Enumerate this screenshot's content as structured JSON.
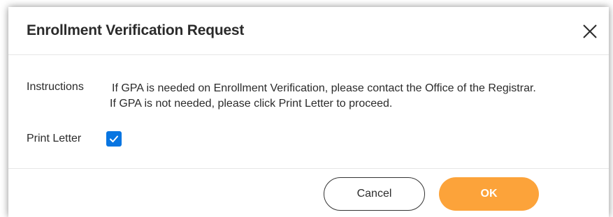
{
  "dialog": {
    "title": "Enrollment Verification Request",
    "close_icon": "close-icon"
  },
  "form": {
    "instructions_label": "Instructions",
    "instructions_line1": "If GPA is needed on Enrollment Verification, please contact the Office of the Registrar.",
    "instructions_line2": "If GPA is not needed, please click Print Letter to proceed.",
    "print_letter_label": "Print Letter",
    "print_letter_checked": true
  },
  "footer": {
    "cancel_label": "Cancel",
    "ok_label": "OK"
  },
  "colors": {
    "accent": "#0875e1",
    "primary_button": "#fca33a",
    "text": "#2b2b2b"
  }
}
